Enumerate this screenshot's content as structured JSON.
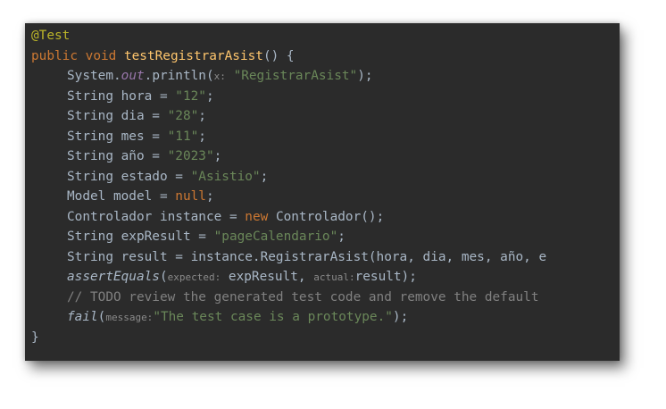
{
  "code": {
    "l1_annotation": "@Test",
    "l2_kw1": "public",
    "l2_kw2": "void",
    "l2_name": "testRegistrarAsist",
    "l2_rest": "() {",
    "l3_a": "System.",
    "l3_out": "out",
    "l3_b": ".println(",
    "l3_hint": "x:",
    "l3_str": "\"RegistrarAsist\"",
    "l3_end": ");",
    "l4_decl": "String hora = ",
    "l4_val": "\"12\"",
    "l5_decl": "String dia = ",
    "l5_val": "\"28\"",
    "l6_decl": "String mes = ",
    "l6_val": "\"11\"",
    "l7_decl": "String año = ",
    "l7_val": "\"2023\"",
    "l8_decl": "String estado = ",
    "l8_val": "\"Asistio\"",
    "l9_decl": "Model model = ",
    "l9_val": "null",
    "l10_decl": "Controlador instance = ",
    "l10_new": "new",
    "l10_rest": " Controlador();",
    "l11_decl": "String expResult = ",
    "l11_val": "\"pageCalendario\"",
    "l12_text": "String result = instance.RegistrarAsist(hora, dia, mes, año, e",
    "l13_call": "assertEquals",
    "l13_hint1": "expected:",
    "l13_arg1": " expResult, ",
    "l13_hint2": "actual:",
    "l13_arg2": "result);",
    "l14_comment": "// TODO review the generated test code and remove the default",
    "l15_call": "fail",
    "l15_hint": "message:",
    "l15_str": "\"The test case is a prototype.\"",
    "l15_end": ");",
    "l16_brace": "}"
  },
  "colors": {
    "background": "#2b2b2b",
    "keyword": "#cc7832",
    "string": "#6a8759",
    "method": "#ffc66d",
    "annotation": "#bbb529",
    "field": "#9876aa",
    "comment": "#808080",
    "text": "#a9b7c6"
  }
}
